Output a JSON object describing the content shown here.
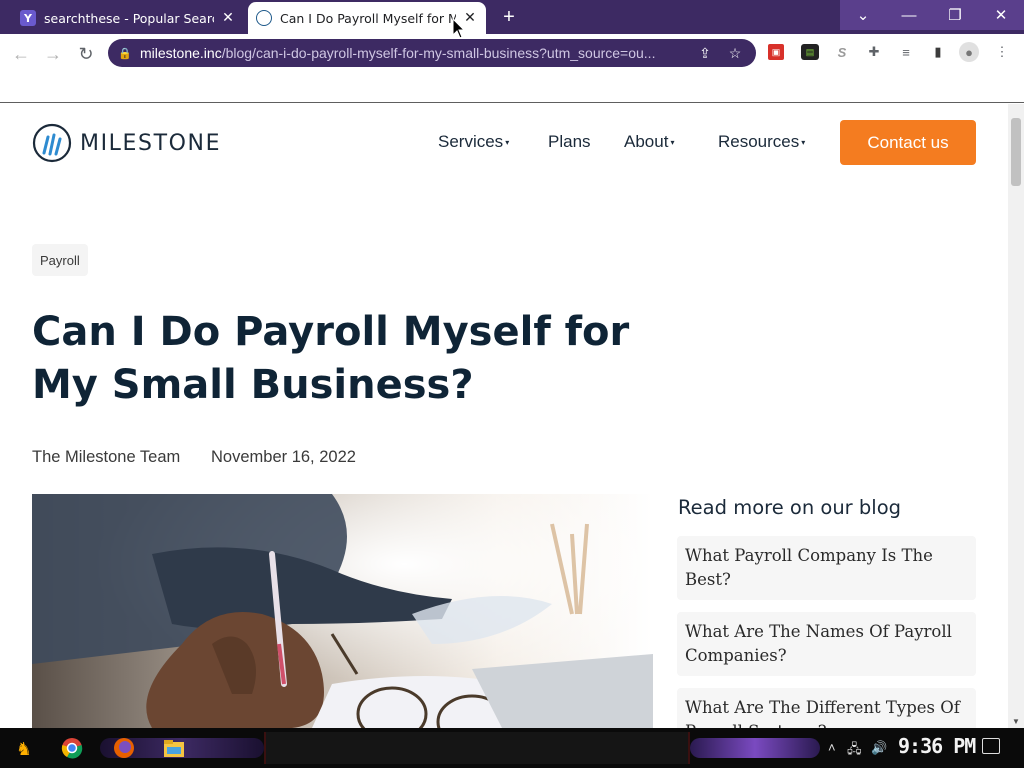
{
  "browser": {
    "tabs": [
      {
        "favicon": "Y",
        "title": "searchthese - Popular Search T",
        "active": false
      },
      {
        "favicon": "//",
        "title": "Can I Do Payroll Myself for My",
        "active": true
      }
    ],
    "new_tab": "+",
    "url_host": "milestone.inc",
    "url_path": "/blog/can-i-do-payroll-myself-for-my-small-business?utm_source=ou...",
    "extensions": [
      "pdf-icon",
      "tv-icon",
      "s-icon",
      "puzzle-icon",
      "playlist-icon",
      "sidepanel-icon",
      "profile-icon",
      "menu-icon"
    ]
  },
  "site": {
    "logo_text": "MILESTONE",
    "nav": [
      {
        "label": "Services",
        "has_caret": true
      },
      {
        "label": "Plans",
        "has_caret": false
      },
      {
        "label": "About",
        "has_caret": true
      },
      {
        "label": "Resources",
        "has_caret": true
      }
    ],
    "caret": "▾",
    "cta_label": "Contact us"
  },
  "article": {
    "tag": "Payroll",
    "title": "Can I Do Payroll Myself for My Small Business?",
    "author": "The Milestone Team",
    "date": "November 16, 2022"
  },
  "sidebar": {
    "title": "Read more on our blog",
    "items": [
      "What Payroll Company Is The Best?",
      "What Are The Names Of Payroll Companies?",
      "What Are The Different Types Of Payroll Systems?"
    ]
  },
  "taskbar": {
    "clock": "9:36 PM"
  },
  "colors": {
    "chrome_purple": "#3d2a63",
    "cta_orange": "#f47c20",
    "heading_navy": "#0f2436"
  }
}
